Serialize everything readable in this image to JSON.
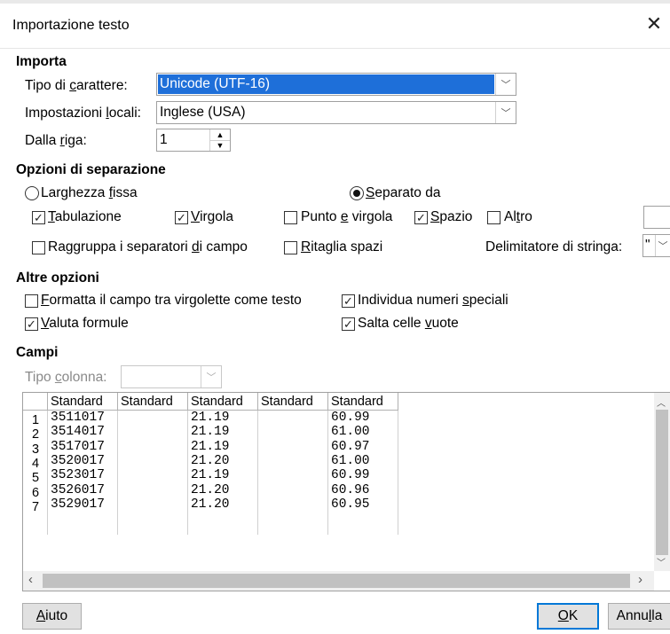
{
  "window": {
    "title": "Importazione testo"
  },
  "import": {
    "section": "Importa",
    "charset_label": "Tipo di carattere:",
    "charset_value": "Unicode (UTF-16)",
    "locale_label": "Impostazioni locali:",
    "locale_value": "Inglese (USA)",
    "from_row_label": "Dalla riga:",
    "from_row_value": "1"
  },
  "separator": {
    "section": "Opzioni di separazione",
    "fixed_width": {
      "label": "Larghezza fissa",
      "selected": false
    },
    "separated_by": {
      "label": "Separato da",
      "selected": true
    },
    "tab": {
      "label": "Tabulazione",
      "checked": true
    },
    "comma": {
      "label": "Virgola",
      "checked": true
    },
    "semicolon": {
      "label": "Punto e virgola",
      "checked": false
    },
    "space": {
      "label": "Spazio",
      "checked": true
    },
    "other": {
      "label": "Altro",
      "checked": false
    },
    "merge": {
      "label": "Raggruppa i separatori di campo",
      "checked": false
    },
    "trim": {
      "label": "Ritaglia spazi",
      "checked": false
    },
    "string_delimiter_label": "Delimitatore di stringa:",
    "string_delimiter_value": "\""
  },
  "other_options": {
    "section": "Altre opzioni",
    "quoted_as_text": {
      "label": "Formatta il campo tra virgolette come testo",
      "checked": false
    },
    "detect_special": {
      "label": "Individua numeri speciali",
      "checked": true
    },
    "evaluate_formulas": {
      "label": "Valuta formule",
      "checked": true
    },
    "skip_empty": {
      "label": "Salta celle vuote",
      "checked": true
    }
  },
  "fields": {
    "section": "Campi",
    "column_type_label": "Tipo colonna:",
    "headers": [
      "Standard",
      "Standard",
      "Standard",
      "Standard",
      "Standard"
    ],
    "rows": [
      {
        "n": "1",
        "c": [
          "3511017",
          "",
          "21.19",
          "",
          "60.99"
        ]
      },
      {
        "n": "2",
        "c": [
          "3514017",
          "",
          "21.19",
          "",
          "61.00"
        ]
      },
      {
        "n": "3",
        "c": [
          "3517017",
          "",
          "21.19",
          "",
          "60.97"
        ]
      },
      {
        "n": "4",
        "c": [
          "3520017",
          "",
          "21.20",
          "",
          "61.00"
        ]
      },
      {
        "n": "5",
        "c": [
          "3523017",
          "",
          "21.19",
          "",
          "60.99"
        ]
      },
      {
        "n": "6",
        "c": [
          "3526017",
          "",
          "21.20",
          "",
          "60.96"
        ]
      },
      {
        "n": "7",
        "c": [
          "3529017",
          "",
          "21.20",
          "",
          "60.95"
        ]
      }
    ]
  },
  "buttons": {
    "help": "Aiuto",
    "ok": "OK",
    "cancel": "Annulla"
  }
}
